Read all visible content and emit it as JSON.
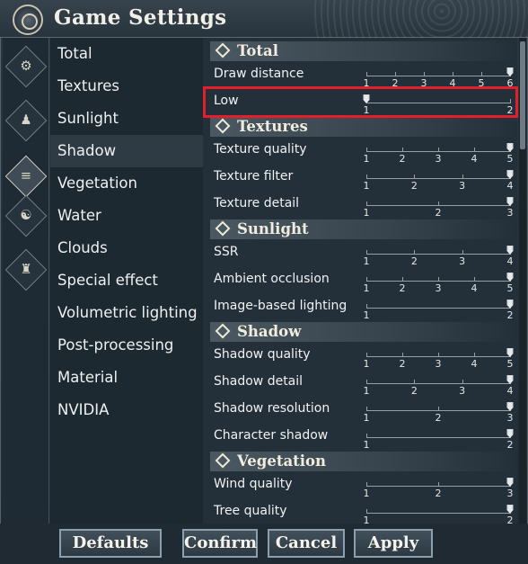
{
  "window": {
    "title": "Game Settings"
  },
  "icons": [
    {
      "name": "gear-icon"
    },
    {
      "name": "character-icon"
    },
    {
      "name": "list-icon"
    },
    {
      "name": "creature-icon"
    },
    {
      "name": "profile-icon"
    }
  ],
  "categories": [
    "Total",
    "Textures",
    "Sunlight",
    "Shadow",
    "Vegetation",
    "Water",
    "Clouds",
    "Special effect",
    "Volumetric lighting",
    "Post-processing",
    "Material",
    "NVIDIA"
  ],
  "sections": [
    {
      "title": "Total",
      "rows": [
        {
          "label": "Draw distance",
          "ticks": [
            "1",
            "2",
            "3",
            "4",
            "5",
            "6"
          ],
          "value": 6
        },
        {
          "label": "Low",
          "ticks": [
            "1",
            "2"
          ],
          "value": 1
        }
      ]
    },
    {
      "title": "Textures",
      "rows": [
        {
          "label": "Texture quality",
          "ticks": [
            "1",
            "2",
            "3",
            "4",
            "5"
          ],
          "value": 5
        },
        {
          "label": "Texture filter",
          "ticks": [
            "1",
            "2",
            "3",
            "4"
          ],
          "value": 4
        },
        {
          "label": "Texture detail",
          "ticks": [
            "1",
            "2",
            "3"
          ],
          "value": 3
        }
      ]
    },
    {
      "title": "Sunlight",
      "rows": [
        {
          "label": "SSR",
          "ticks": [
            "1",
            "2",
            "3",
            "4"
          ],
          "value": 4
        },
        {
          "label": "Ambient occlusion",
          "ticks": [
            "1",
            "2",
            "3",
            "4",
            "5"
          ],
          "value": 5
        },
        {
          "label": "Image-based lighting",
          "ticks": [
            "1",
            "2"
          ],
          "value": 2
        }
      ]
    },
    {
      "title": "Shadow",
      "rows": [
        {
          "label": "Shadow quality",
          "ticks": [
            "1",
            "2",
            "3",
            "4",
            "5"
          ],
          "value": 5
        },
        {
          "label": "Shadow detail",
          "ticks": [
            "1",
            "2",
            "3",
            "4"
          ],
          "value": 4
        },
        {
          "label": "Shadow resolution",
          "ticks": [
            "1",
            "2",
            "3"
          ],
          "value": 3
        },
        {
          "label": "Character shadow",
          "ticks": [
            "1",
            "2"
          ],
          "value": 2
        }
      ]
    },
    {
      "title": "Vegetation",
      "rows": [
        {
          "label": "Wind quality",
          "ticks": [
            "1",
            "2",
            "3"
          ],
          "value": 3
        },
        {
          "label": "Tree quality",
          "ticks": [
            "1",
            "2"
          ],
          "value": 2
        }
      ]
    }
  ],
  "buttons": {
    "defaults": "Defaults",
    "confirm": "Confirm",
    "cancel": "Cancel",
    "apply": "Apply"
  },
  "colors": {
    "highlight": "#e41e2a",
    "panel": "#243039",
    "text": "#f0f2f3"
  }
}
